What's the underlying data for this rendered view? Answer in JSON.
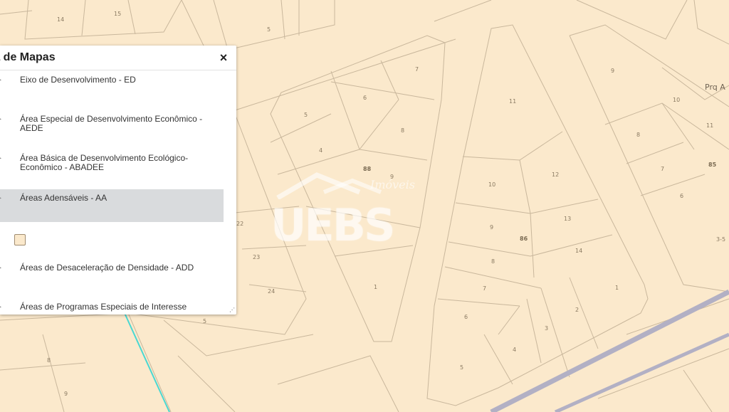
{
  "legend": {
    "title": "ta de Mapas",
    "close_label": "×",
    "items": [
      {
        "label": "Eixo de Desenvolvimento - ED"
      },
      {
        "label": "Área Especial de Desenvolvimento Econômico - AEDE"
      },
      {
        "label": "Área Básica de Desenvolvimento Ecológico-Econômico - ABADEE"
      },
      {
        "label": "Áreas Adensáveis - AA"
      },
      {
        "label": "Áreas de Desaceleração de Densidade - ADD"
      },
      {
        "label": "Áreas de Programas Especiais de Interesse Social - AEIS"
      }
    ],
    "swatch_color": "#fbe9cc",
    "highlight_color": "#d9dbdd"
  },
  "map": {
    "background_color": "#fbe9cc",
    "lot_line_color": "#c9b79c",
    "area_label": "Prq A",
    "block_labels": [
      "88",
      "86",
      "85"
    ],
    "lot_numbers": [
      "14",
      "15",
      "5",
      "7",
      "6",
      "5",
      "8",
      "4",
      "9",
      "11",
      "9",
      "10",
      "12",
      "11",
      "8",
      "7",
      "6",
      "10",
      "9",
      "13",
      "14",
      "8",
      "7",
      "6",
      "5",
      "4",
      "3",
      "2",
      "1",
      "1",
      "22",
      "23",
      "24",
      "5",
      "8",
      "9",
      "3-5"
    ]
  },
  "watermark": {
    "text": "UEBS",
    "script": "Imóveis"
  }
}
